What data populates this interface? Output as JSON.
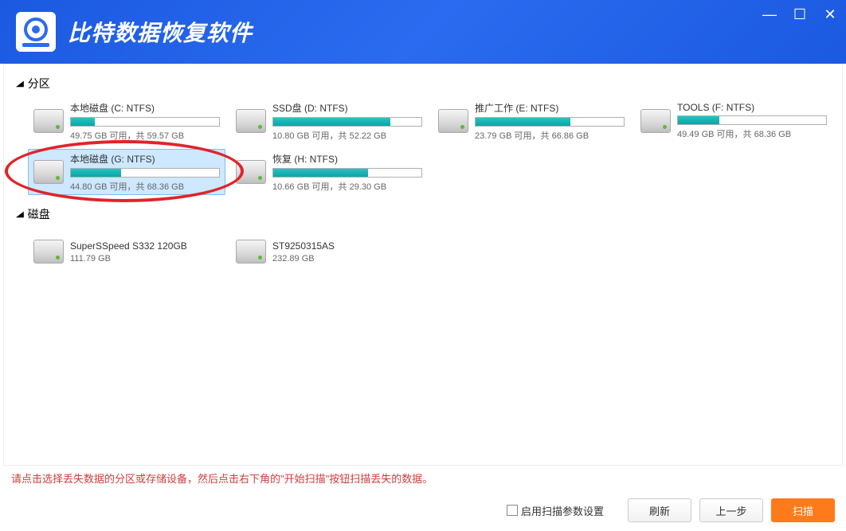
{
  "app": {
    "title": "比特数据恢复软件"
  },
  "window_controls": {
    "min": "—",
    "max": "☐",
    "close": "✕"
  },
  "sections": {
    "partition": {
      "label": "分区"
    },
    "disk": {
      "label": "磁盘"
    }
  },
  "partitions": [
    {
      "name": "本地磁盘 (C: NTFS)",
      "free": "49.75 GB",
      "total": "59.57 GB",
      "fill_pct": 16,
      "selected": false
    },
    {
      "name": "SSD盘 (D: NTFS)",
      "free": "10.80 GB",
      "total": "52.22 GB",
      "fill_pct": 79,
      "selected": false
    },
    {
      "name": "推广工作 (E: NTFS)",
      "free": "23.79 GB",
      "total": "66.86 GB",
      "fill_pct": 64,
      "selected": false
    },
    {
      "name": "TOOLS (F: NTFS)",
      "free": "49.49 GB",
      "total": "68.36 GB",
      "fill_pct": 28,
      "selected": false
    },
    {
      "name": "本地磁盘 (G: NTFS)",
      "free": "44.80 GB",
      "total": "68.36 GB",
      "fill_pct": 34,
      "selected": true
    },
    {
      "name": "恢复 (H: NTFS)",
      "free": "10.66 GB",
      "total": "29.30 GB",
      "fill_pct": 64,
      "selected": false
    }
  ],
  "disks": [
    {
      "name": "SuperSSpeed S332 120GB",
      "size": "111.79 GB"
    },
    {
      "name": "ST9250315AS",
      "size": "232.89 GB"
    }
  ],
  "strings": {
    "free_label": "可用，共",
    "hint": "请点击选择丢失数据的分区或存储设备，然后点击右下角的\"开始扫描\"按钮扫描丢失的数据。",
    "enable_params": "启用扫描参数设置",
    "refresh": "刷新",
    "prev": "上一步",
    "scan": "扫描"
  },
  "colors": {
    "accent": "#1b5ae0",
    "primary_btn": "#ff7a1a",
    "highlight_ring": "#e1232a"
  }
}
